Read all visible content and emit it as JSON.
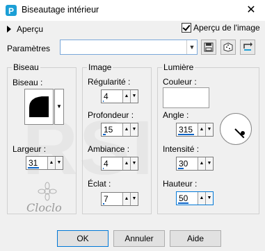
{
  "window": {
    "title": "Biseautage intérieur",
    "close_glyph": "✕"
  },
  "preview": {
    "label": "Aperçu",
    "toggle_glyph": "▶"
  },
  "preview_image": {
    "label": "Aperçu de l'image",
    "checked": true
  },
  "presets": {
    "label": "Paramètres",
    "value": ""
  },
  "groups": {
    "biseau": {
      "title": "Biseau",
      "bevel_label": "Biseau :",
      "width_label": "Largeur :",
      "width_value": "31",
      "width_level": 0.62
    },
    "image": {
      "title": "Image",
      "smoothness_label": "Régularité :",
      "smoothness_value": "4",
      "smoothness_level": 0.04,
      "depth_label": "Profondeur :",
      "depth_value": "15",
      "depth_level": 0.15,
      "ambience_label": "Ambiance :",
      "ambience_value": "4",
      "ambience_level": 0.04,
      "shininess_label": "Éclat :",
      "shininess_value": "7",
      "shininess_level": 0.07
    },
    "lumiere": {
      "title": "Lumière",
      "color_label": "Couleur :",
      "color_value": "#ffffff",
      "angle_label": "Angle :",
      "angle_value": "315",
      "angle_level": 0.875,
      "intensity_label": "Intensité :",
      "intensity_value": "30",
      "intensity_level": 0.3,
      "elevation_label": "Hauteur :",
      "elevation_value": "50",
      "elevation_level": 0.56
    }
  },
  "buttons": {
    "ok": "OK",
    "cancel": "Annuler",
    "help": "Aide"
  },
  "watermark": "Cloclo",
  "colors": {
    "accent": "#0078d7",
    "bar": "#0a64c8"
  }
}
